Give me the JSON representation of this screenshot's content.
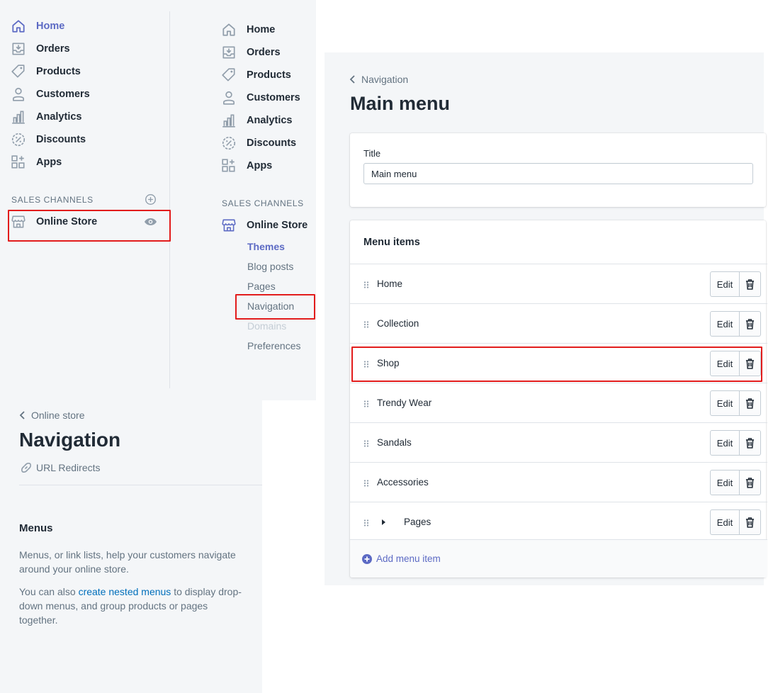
{
  "sidebar_primary": {
    "items": [
      {
        "label": "Home",
        "icon": "home-icon"
      },
      {
        "label": "Orders",
        "icon": "orders-icon"
      },
      {
        "label": "Products",
        "icon": "tag-icon"
      },
      {
        "label": "Customers",
        "icon": "person-icon"
      },
      {
        "label": "Analytics",
        "icon": "bar-chart-icon"
      },
      {
        "label": "Discounts",
        "icon": "discount-icon"
      },
      {
        "label": "Apps",
        "icon": "apps-icon"
      }
    ],
    "section_label": "SALES CHANNELS",
    "channel": "Online Store"
  },
  "sidebar_expanded": {
    "items": [
      {
        "label": "Home"
      },
      {
        "label": "Orders"
      },
      {
        "label": "Products"
      },
      {
        "label": "Customers"
      },
      {
        "label": "Analytics"
      },
      {
        "label": "Discounts"
      },
      {
        "label": "Apps"
      }
    ],
    "section_label": "SALES CHANNELS",
    "channel": "Online Store",
    "sub_items": [
      {
        "label": "Themes"
      },
      {
        "label": "Blog posts"
      },
      {
        "label": "Pages"
      },
      {
        "label": "Navigation"
      },
      {
        "label": "Domains"
      },
      {
        "label": "Preferences"
      }
    ]
  },
  "navigation_page": {
    "back_label": "Online store",
    "title": "Navigation",
    "url_redirects": "URL Redirects",
    "menus_heading": "Menus",
    "desc1_line1": "Menus, or link lists, help your customers navigate",
    "desc1_line2": "around your online store.",
    "desc2_pre": "You can also ",
    "desc2_link": "create nested menus",
    "desc2_post": " to display drop-",
    "desc2_line2": "down menus, and group products or pages",
    "desc2_line3": "together."
  },
  "main_menu": {
    "back_label": "Navigation",
    "title": "Main menu",
    "title_field_label": "Title",
    "title_field_value": "Main menu",
    "menu_items_heading": "Menu items",
    "items": [
      {
        "label": "Home"
      },
      {
        "label": "Collection"
      },
      {
        "label": "Shop"
      },
      {
        "label": "Trendy Wear"
      },
      {
        "label": "Sandals"
      },
      {
        "label": "Accessories"
      },
      {
        "label": "Pages"
      }
    ],
    "edit_label": "Edit",
    "add_item_label": "Add menu item"
  },
  "colors": {
    "accent": "#5c6ac4",
    "highlight": "#e21c1c",
    "link": "#006fbb"
  }
}
